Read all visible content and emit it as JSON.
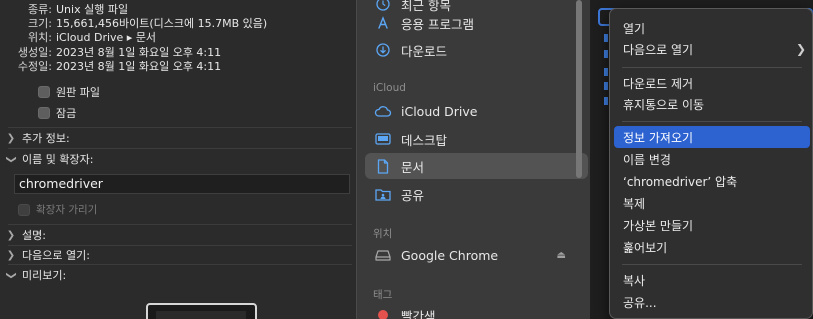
{
  "info": {
    "meta": [
      {
        "key": "종류:",
        "value": "Unix 실행 파일"
      },
      {
        "key": "크기:",
        "value": "15,661,456바이트(디스크에 15.7MB 있음)"
      },
      {
        "key": "위치:",
        "value": "iCloud Drive ▸ 문서"
      },
      {
        "key": "생성일:",
        "value": "2023년 8월 1일 화요일 오후 4:11"
      },
      {
        "key": "수정일:",
        "value": "2023년 8월 1일 화요일 오후 4:11"
      }
    ],
    "stationery_label": "원판 파일",
    "locked_label": "잠금",
    "more_info_label": "추가 정보:",
    "name_ext_label": "이름 및 확장자:",
    "filename": "chromedriver",
    "hide_extension_label": "확장자 가리기",
    "comments_label": "설명:",
    "open_with_label": "다음으로 열기:",
    "preview_label": "미리보기:"
  },
  "sidebar": {
    "partial_top": "최근 항목",
    "applications": "응용 프로그램",
    "downloads": "다운로드",
    "icloud_header": "iCloud",
    "icloud_drive": "iCloud Drive",
    "desktop": "데스크탑",
    "documents": "문서",
    "shared": "공유",
    "locations_header": "위치",
    "google_chrome": "Google Chrome",
    "tags_header": "태그",
    "tag_red": "빨간색"
  },
  "menu": {
    "items": [
      "열기",
      "다음으로 열기",
      "다운로드 제거",
      "휴지통으로 이동",
      "정보 가져오기",
      "이름 변경",
      "‘chromedriver’ 압축",
      "복제",
      "가상본 만들기",
      "훑어보기",
      "복사",
      "공유..."
    ]
  },
  "colors": {
    "accent": "#2d62d1",
    "folder_icon": "#5ba6f5",
    "tag_red": "#e5524d"
  }
}
